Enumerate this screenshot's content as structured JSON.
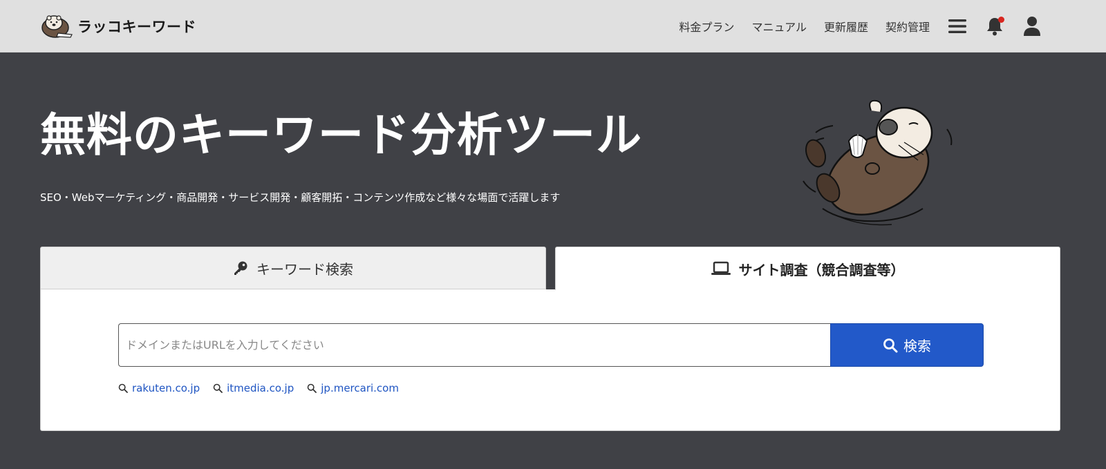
{
  "brand": {
    "name": "ラッコキーワード",
    "logo_icon": "otter-logo-icon"
  },
  "nav": {
    "links": [
      "料金プラン",
      "マニュアル",
      "更新履歴",
      "契約管理"
    ],
    "menu_icon": "hamburger-menu-icon",
    "bell_icon": "bell-icon",
    "user_icon": "user-icon",
    "notification_dot_color": "#d8261f"
  },
  "hero": {
    "title": "無料のキーワード分析ツール",
    "subtitle": "SEO・Webマーケティング・商品開発・サービス開発・顧客開拓・コンテンツ作成など様々な場面で活躍します",
    "mascot": "sleeping-otter-illustration"
  },
  "tabs": [
    {
      "label": "キーワード検索",
      "icon": "key-icon",
      "active": false
    },
    {
      "label": "サイト調査（競合調査等）",
      "icon": "laptop-icon",
      "active": true
    }
  ],
  "search": {
    "placeholder": "ドメインまたはURLを入力してください",
    "value": "",
    "button_label": "検索",
    "button_icon": "search-icon"
  },
  "suggestions": [
    "rakuten.co.jp",
    "itmedia.co.jp",
    "jp.mercari.com"
  ],
  "colors": {
    "hero_bg": "#404146",
    "header_bg": "#e0e0e0",
    "accent": "#2259c9",
    "link": "#1f55c2"
  }
}
